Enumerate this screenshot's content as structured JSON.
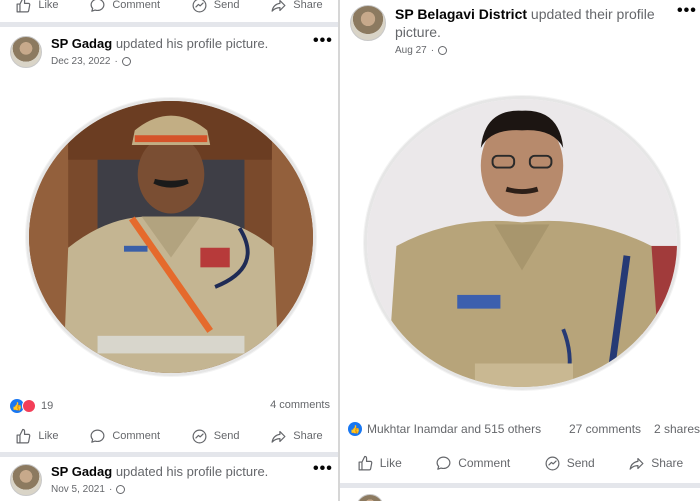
{
  "actions": {
    "like": "Like",
    "comment": "Comment",
    "send": "Send",
    "share": "Share"
  },
  "more_symbol": "•••",
  "left_column": {
    "post1": {
      "author": "SP Gadag",
      "activity": "updated his profile picture.",
      "date": "Dec 23, 2022",
      "reaction_count": "19",
      "comments": "4 comments"
    },
    "post2": {
      "author": "SP Gadag",
      "activity": "updated his profile picture.",
      "date": "Nov 5, 2021"
    }
  },
  "right_column": {
    "post1": {
      "author": "SP Belagavi District",
      "activity": "updated their profile picture.",
      "date": "Aug 27",
      "reactions_text": "Mukhtar Inamdar and 515 others",
      "comments": "27 comments",
      "shares": "2 shares"
    }
  },
  "colors": {
    "like_blue": "#1877f2",
    "love_red": "#f33e58",
    "meta_gray": "#65676b",
    "uniform_khaki": "#c4b592"
  },
  "icons": [
    "thumbs-up-icon",
    "comment-bubble-icon",
    "messenger-icon",
    "share-arrow-icon",
    "globe-icon"
  ]
}
